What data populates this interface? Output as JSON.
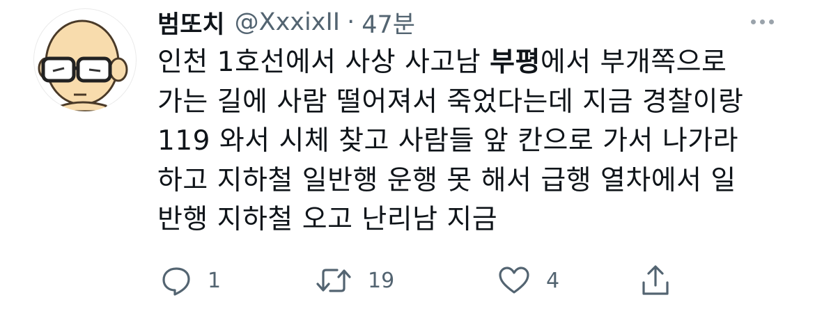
{
  "tweet": {
    "display_name": "범또치",
    "handle": "@XxxixII",
    "separator": "·",
    "time": "47분",
    "body": {
      "line1_pre": "인천 1호선에서 사상 사고남 ",
      "line1_bold": "부평",
      "line1_post": "에서 부개쪽으로",
      "line2": "가는 길에 사람 떨어져서 죽었다는데 지금 경찰이랑",
      "line3": "119 와서 시체 찾고 사람들 앞 칸으로 가서 나가라",
      "line4": "하고 지하철 일반행 운행 못 해서 급행 열차에서 일",
      "line5": "반행 지하철 오고 난리남 지금"
    },
    "actions": {
      "reply_count": "1",
      "retweet_count": "19",
      "like_count": "4"
    },
    "icons": {
      "reply": "reply-bubble-icon",
      "retweet": "retweet-icon",
      "like": "heart-icon",
      "share": "share-upload-icon",
      "more": "more-dots-icon"
    },
    "colors": {
      "text": "#0f1419",
      "secondary": "#536471",
      "avatar_skin": "#f6d9a8"
    }
  }
}
